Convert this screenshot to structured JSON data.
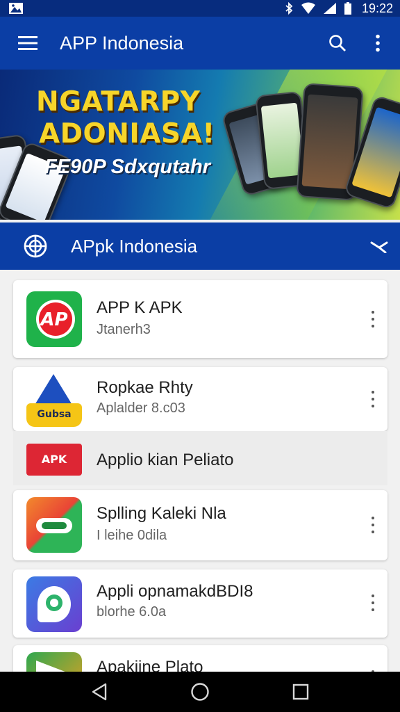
{
  "status_bar": {
    "time": "19:22",
    "icons": [
      "image-icon",
      "bluetooth-icon",
      "wifi-icon",
      "signal-icon",
      "battery-icon"
    ]
  },
  "app_bar": {
    "title": "APP Indonesia",
    "icons": [
      "menu-icon",
      "search-icon",
      "more-vert-icon"
    ]
  },
  "banner": {
    "line1": "NGATARPY",
    "line2": "ADONIASA!",
    "subtitle": "FE90P Sdxqutahr"
  },
  "section": {
    "title": "APpk Indonesia",
    "icons": [
      "globe-icon",
      "collapse-icon"
    ]
  },
  "apps": [
    {
      "name": "APP K APK",
      "subtitle": "Jtanerh3",
      "icon_text": "AP"
    },
    {
      "name": "Ropkae Rhty",
      "subtitle": "Aplalder 8.c03",
      "icon_text": "Gubsa"
    },
    {
      "name": "Applio kian Peliato",
      "subtitle": "",
      "icon_text": "APK"
    },
    {
      "name": "Splling Kaleki Nla",
      "subtitle": "I leihe 0dila",
      "icon_text": ""
    },
    {
      "name": "Appli opnamakdBDI8",
      "subtitle": "blorhe 6.0a",
      "icon_text": ""
    },
    {
      "name": "Apakiine Plato",
      "subtitle": "",
      "icon_text": ""
    }
  ],
  "colors": {
    "primary": "#0b3ea5",
    "status_bar": "#072c7e",
    "banner_text": "#f7d52a",
    "nav_bar": "#000000"
  },
  "nav_bar": {
    "icons": [
      "back-icon",
      "home-icon",
      "recents-icon"
    ]
  }
}
